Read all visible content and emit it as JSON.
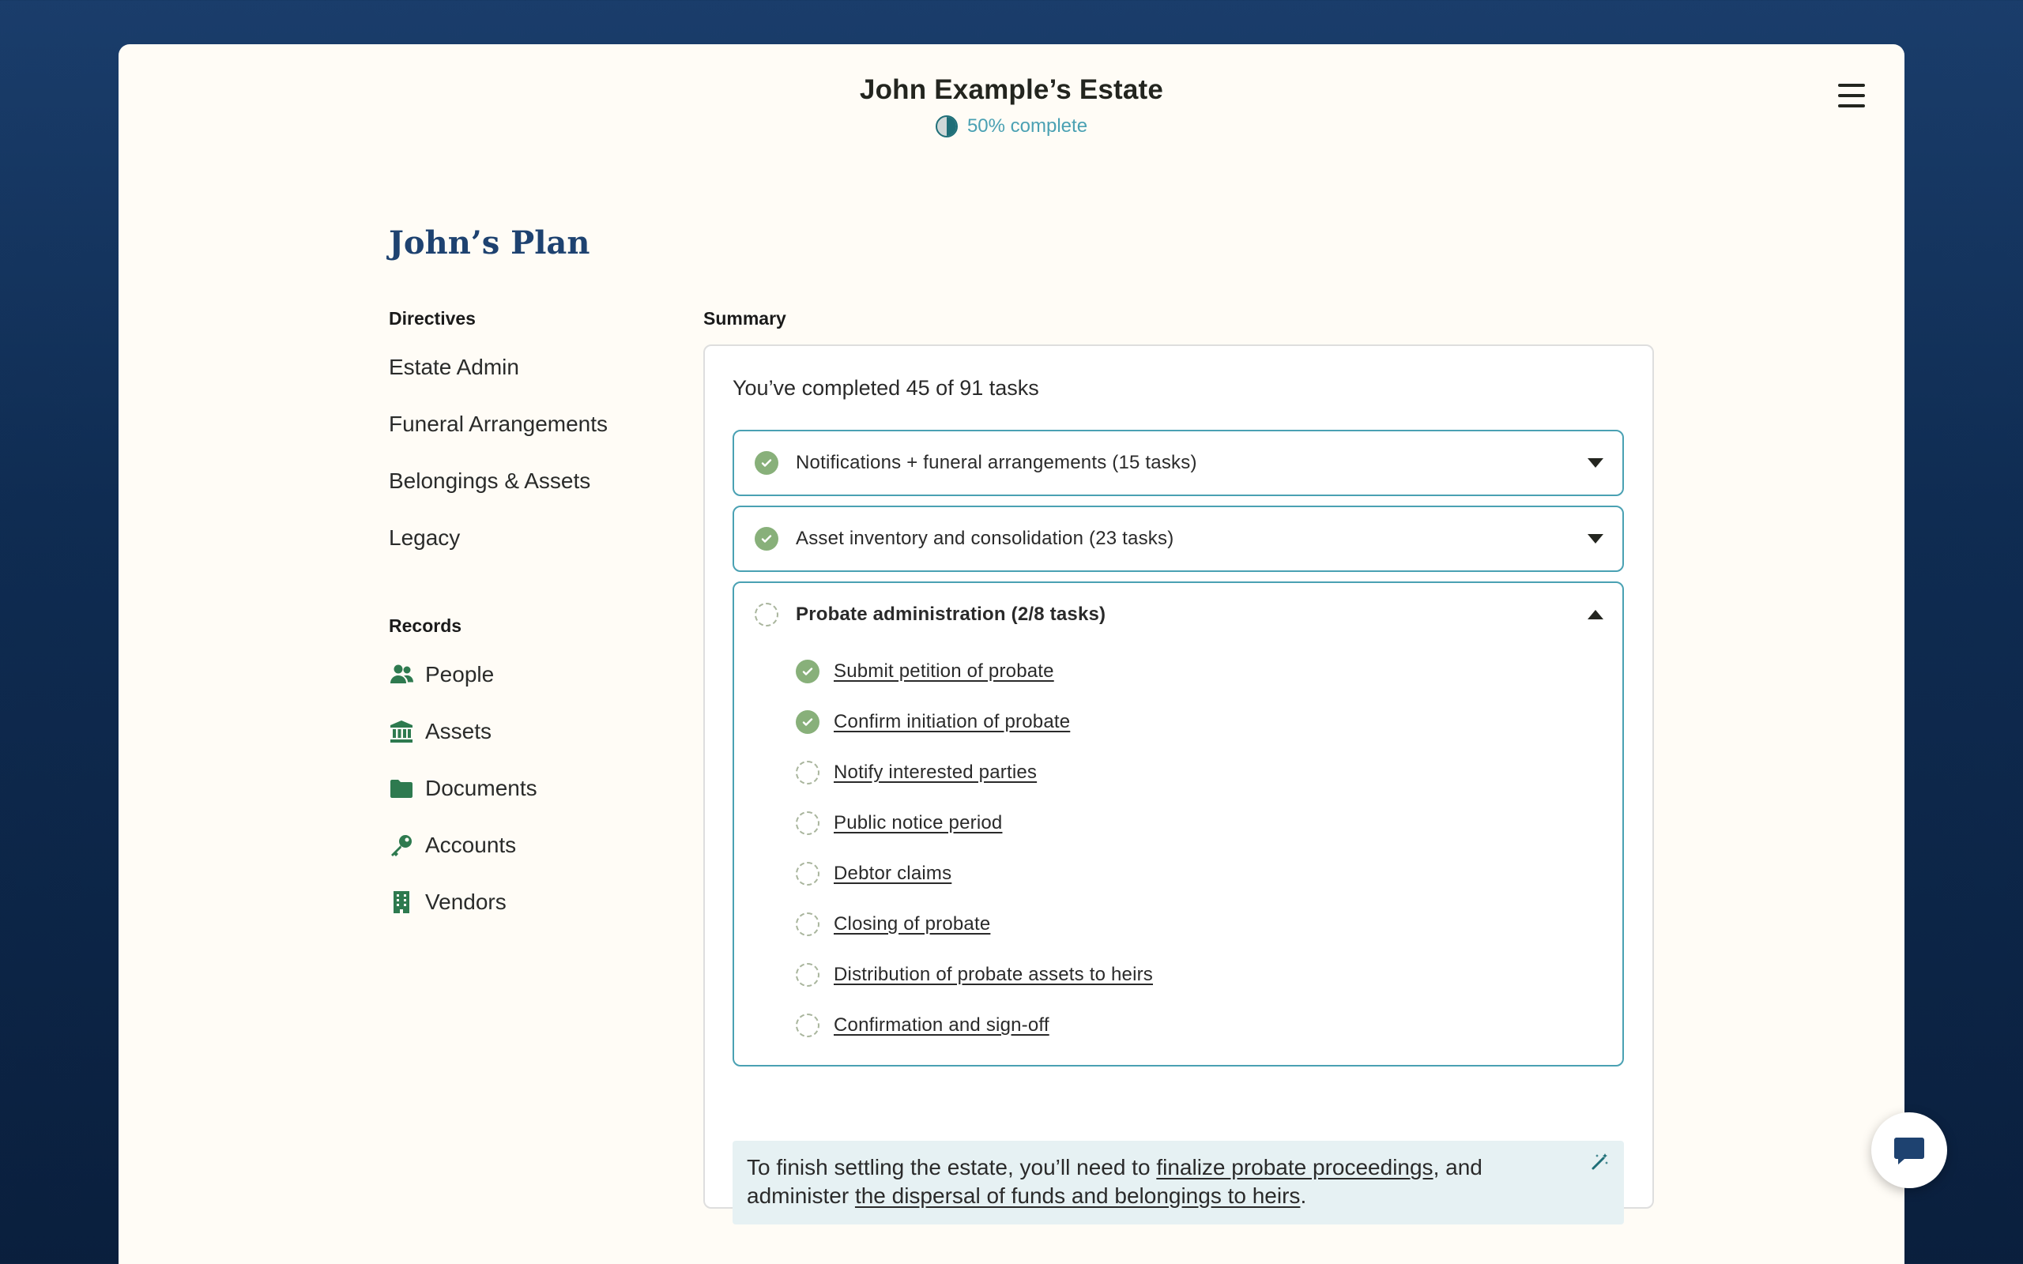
{
  "header": {
    "title": "John Example’s Estate",
    "progress_fraction": 0.5,
    "progress_text": "50% complete"
  },
  "plan": {
    "title": "John’s Plan"
  },
  "sidebar": {
    "directives_label": "Directives",
    "directives": [
      {
        "label": "Estate Admin"
      },
      {
        "label": "Funeral Arrangements"
      },
      {
        "label": "Belongings & Assets"
      },
      {
        "label": "Legacy"
      }
    ],
    "records_label": "Records",
    "records": [
      {
        "label": "People",
        "icon": "people-icon"
      },
      {
        "label": "Assets",
        "icon": "bank-icon"
      },
      {
        "label": "Documents",
        "icon": "folder-icon"
      },
      {
        "label": "Accounts",
        "icon": "key-icon"
      },
      {
        "label": "Vendors",
        "icon": "building-icon"
      }
    ]
  },
  "summary": {
    "label": "Summary",
    "completed_text": "You’ve completed 45 of 91 tasks",
    "groups": [
      {
        "title": "Notifications + funeral arrangements (15 tasks)",
        "done": true,
        "expanded": false
      },
      {
        "title": "Asset inventory and consolidation (23 tasks)",
        "done": true,
        "expanded": false
      },
      {
        "title": "Probate administration (2/8 tasks)",
        "done": false,
        "expanded": true
      }
    ],
    "probate_tasks": [
      {
        "label": "Submit petition of probate",
        "done": true
      },
      {
        "label": "Confirm initiation of probate",
        "done": true
      },
      {
        "label": "Notify interested parties",
        "done": false
      },
      {
        "label": "Public notice period",
        "done": false
      },
      {
        "label": "Debtor claims",
        "done": false
      },
      {
        "label": "Closing of probate",
        "done": false
      },
      {
        "label": "Distribution of probate assets to heirs",
        "done": false
      },
      {
        "label": "Confirmation and sign-off",
        "done": false
      }
    ],
    "info": {
      "text_1": "To finish settling the estate, you’ll need to ",
      "link_1": "finalize probate proceedings",
      "text_2": ", and administer ",
      "link_2": "the dispersal of funds and belongings to heirs",
      "text_3": "."
    }
  },
  "colors": {
    "accent_teal": "#4aa1b3",
    "check_green": "#88b07a",
    "icon_green": "#2e7a4f",
    "plan_title_blue": "#1e4270",
    "card_bg": "#fffcf6",
    "info_bg": "#e6f1f3"
  }
}
